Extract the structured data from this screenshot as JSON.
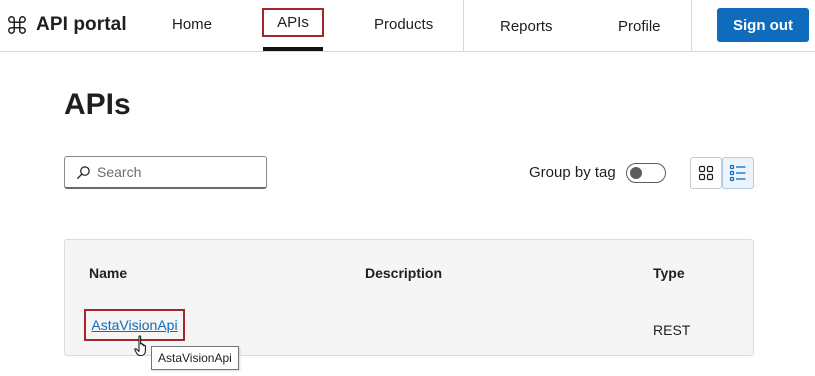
{
  "brand": {
    "title": "API portal",
    "icon": "command-icon"
  },
  "nav": {
    "home": "Home",
    "apis": "APIs",
    "products": "Products",
    "reports": "Reports",
    "profile": "Profile"
  },
  "header": {
    "signout_label": "Sign out"
  },
  "page": {
    "title": "APIs"
  },
  "search": {
    "placeholder": "Search",
    "value": ""
  },
  "group_by_tag": {
    "label": "Group by tag",
    "enabled": false
  },
  "view_toggle": {
    "grid_icon": "grid-view-icon",
    "list_icon": "list-view-icon",
    "selected": "list"
  },
  "table": {
    "columns": {
      "name": "Name",
      "description": "Description",
      "type": "Type"
    },
    "rows": [
      {
        "name": "AstaVisionApi",
        "description": "",
        "type": "REST"
      }
    ]
  },
  "tooltip": {
    "text": "AstaVisionApi"
  },
  "colors": {
    "accent": "#0f6cbd",
    "highlight_border": "#a4262c"
  }
}
